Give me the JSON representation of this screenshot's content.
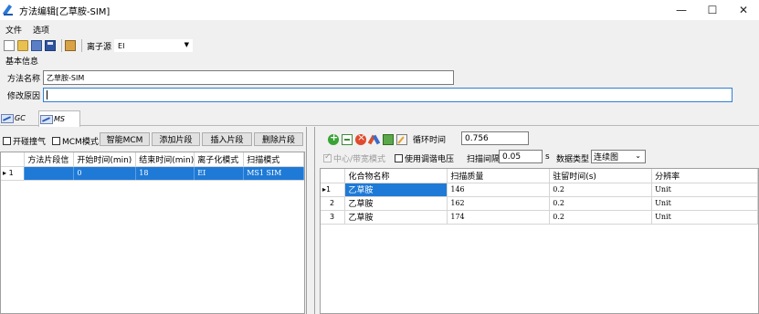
{
  "window": {
    "title": "方法编辑[乙草胺-SIM]",
    "minimize": "—",
    "maximize": "☐",
    "close": "✕"
  },
  "menu": [
    "文件",
    "选项"
  ],
  "toolbar": {
    "ion_source_label": "离子源",
    "ion_source_value": "EI"
  },
  "basic_info": {
    "section_label": "基本信息",
    "method_name_label": "方法名称",
    "method_name_value": "乙草胺-SIM",
    "modify_reason_label": "修改原因",
    "modify_reason_value": ""
  },
  "tabs": [
    {
      "label": "GC"
    },
    {
      "label": "MS"
    }
  ],
  "left": {
    "solvent_delay_label": "开碰撞气",
    "mcm_mode_label": "MCM模式",
    "buttons": {
      "smart_mcm": "智能MCM",
      "add_segment": "添加片段",
      "insert_segment": "插入片段",
      "delete_segment": "删除片段"
    },
    "table": {
      "headers": [
        "方法片段信",
        "开始时间(min)",
        "结束时间(min)",
        "离子化模式",
        "扫描模式"
      ],
      "rows": [
        {
          "index": "1",
          "cells": [
            "",
            "0",
            "18",
            "EI",
            "MS1 SIM"
          ]
        }
      ]
    }
  },
  "right": {
    "cycle_time_label": "循环时间",
    "cycle_time_value": "0.756",
    "center_width_label": "中心/带宽模式",
    "tune_voltage_label": "使用调谐电压",
    "scan_interval_label": "扫描间隔",
    "scan_interval_value": "0.05",
    "scan_interval_unit": "s",
    "data_type_label": "数据类型",
    "data_type_value": "连续图",
    "table": {
      "headers": [
        "化合物名称",
        "扫描质量",
        "驻留时间(s)",
        "分辨率"
      ],
      "rows": [
        {
          "index": "1",
          "cells": [
            "乙草胺",
            "146",
            "0.2",
            "Unit"
          ]
        },
        {
          "index": "2",
          "cells": [
            "乙草胺",
            "162",
            "0.2",
            "Unit"
          ]
        },
        {
          "index": "3",
          "cells": [
            "乙草胺",
            "174",
            "0.2",
            "Unit"
          ]
        }
      ]
    }
  },
  "colors": {
    "selection": "#1e7ad6",
    "focus_border": "#2f7fd4"
  }
}
